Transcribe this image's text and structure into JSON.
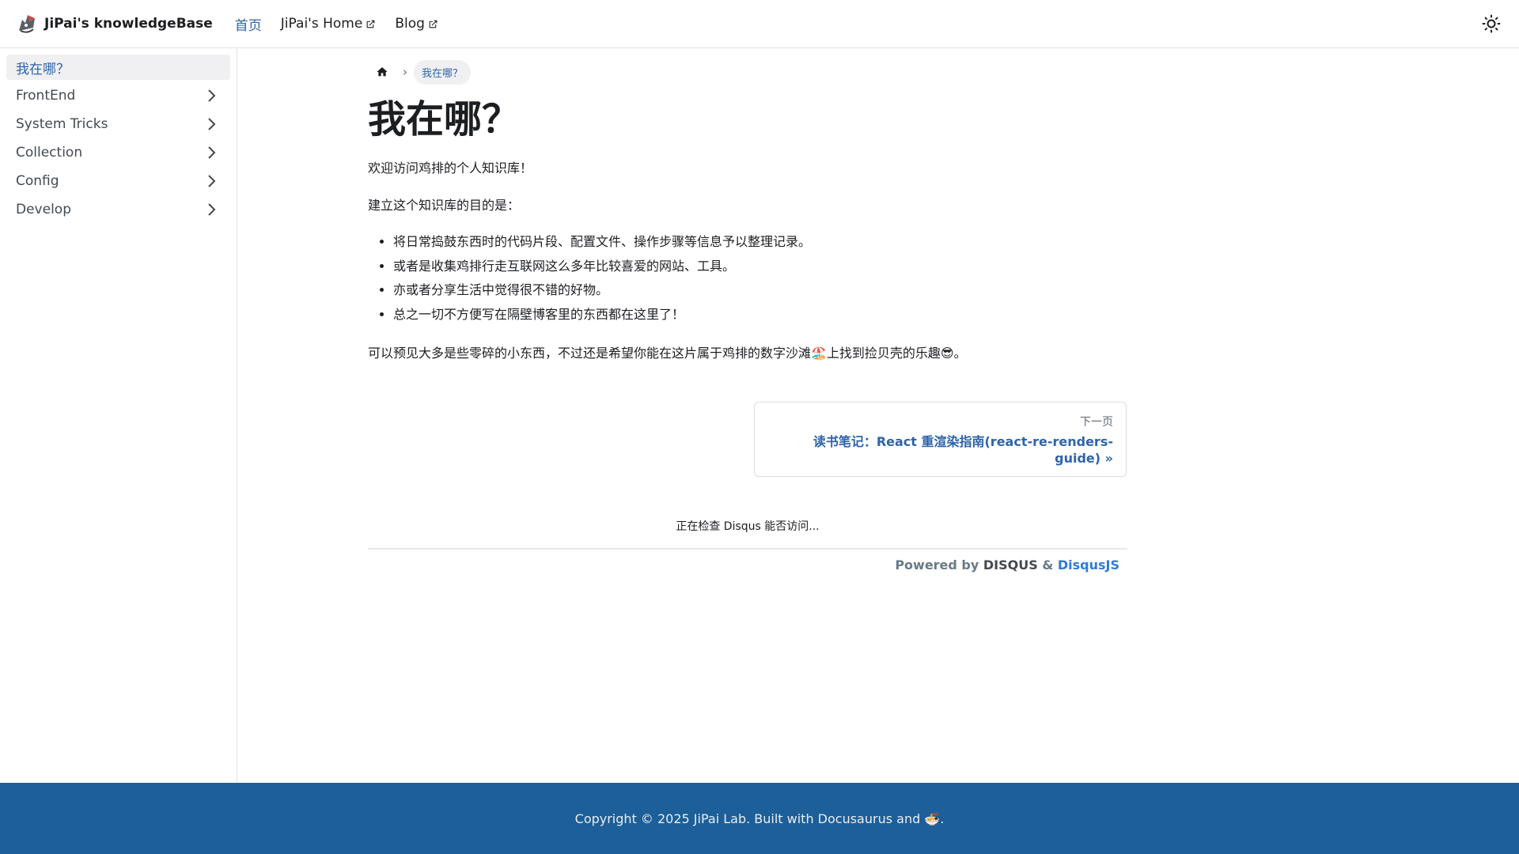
{
  "navbar": {
    "brand_title": "JiPai's knowledgeBase",
    "links": [
      {
        "label": "首页",
        "active": true
      },
      {
        "label": "JiPai's Home",
        "external": true
      },
      {
        "label": "Blog",
        "external": true
      }
    ],
    "theme_icon": "sun-icon"
  },
  "sidebar": {
    "items": [
      {
        "label": "我在哪？",
        "active": true
      },
      {
        "label": "FrontEnd"
      },
      {
        "label": "System Tricks"
      },
      {
        "label": "Collection"
      },
      {
        "label": "Config"
      },
      {
        "label": "Develop"
      }
    ]
  },
  "breadcrumb": {
    "home_icon": "home-icon",
    "current": "我在哪？"
  },
  "article": {
    "title": "我在哪？",
    "intro": "欢迎访问鸡排的个人知识库！",
    "purpose": "建立这个知识库的目的是：",
    "bullets": [
      "将日常捣鼓东西时的代码片段、配置文件、操作步骤等信息予以整理记录。",
      "或者是收集鸡排行走互联网这么多年比较喜爱的网站、工具。",
      "亦或者分享生活中觉得很不错的好物。",
      "总之一切不方便写在隔壁博客里的东西都在这里了！"
    ],
    "closing": "可以预见大多是些零碎的小东西，不过还是希望你能在这片属于鸡排的数字沙滩🏖️上找到捡贝壳的乐趣😎。"
  },
  "pager": {
    "sub_label": "下一页",
    "label": "读书笔记：React 重渲染指南(react-re-renders-guide) »"
  },
  "disqus": {
    "checking": "正在检查 Disqus 能否访问...",
    "powered_prefix": "Powered by ",
    "disqus_word": "DISQUS",
    "amp": " & ",
    "disqusjs": "DisqusJS"
  },
  "footer": {
    "copyright": "Copyright © 2025 JiPai Lab. Built with Docusaurus and 🍜."
  },
  "colors": {
    "accent": "#2e64a8",
    "footer_bg": "#1c5f99"
  }
}
